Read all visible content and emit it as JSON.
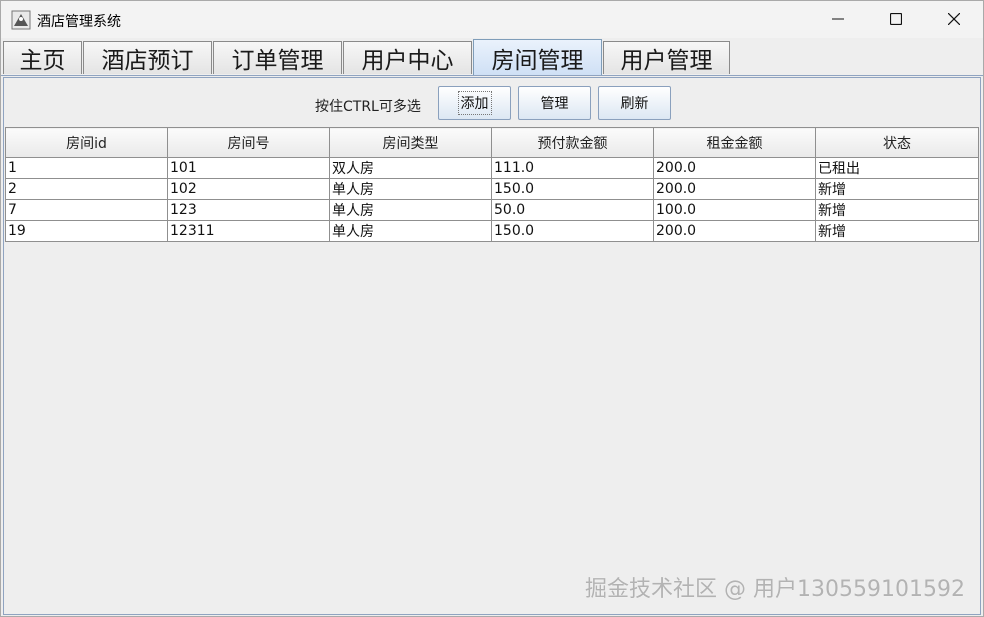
{
  "window": {
    "title": "酒店管理系统",
    "controls": [
      "minimize-icon",
      "maximize-icon",
      "close-icon"
    ]
  },
  "tabs": [
    {
      "label": "主页",
      "active": false
    },
    {
      "label": "酒店预订",
      "active": false
    },
    {
      "label": "订单管理",
      "active": false
    },
    {
      "label": "用户中心",
      "active": false
    },
    {
      "label": "房间管理",
      "active": true
    },
    {
      "label": "用户管理",
      "active": false
    }
  ],
  "toolbar": {
    "hint": "按住CTRL可多选",
    "add_label": "添加",
    "manage_label": "管理",
    "refresh_label": "刷新"
  },
  "table": {
    "headers": [
      "房间id",
      "房间号",
      "房间类型",
      "预付款金额",
      "租金金额",
      "状态"
    ],
    "rows": [
      [
        "1",
        "101",
        "双人房",
        "111.0",
        "200.0",
        "已租出"
      ],
      [
        "2",
        "102",
        "单人房",
        "150.0",
        "200.0",
        "新增"
      ],
      [
        "7",
        "123",
        "单人房",
        "50.0",
        "100.0",
        "新增"
      ],
      [
        "19",
        "12311",
        "单人房",
        "150.0",
        "200.0",
        "新增"
      ]
    ]
  },
  "watermark": "掘金技术社区 @ 用户130559101592"
}
